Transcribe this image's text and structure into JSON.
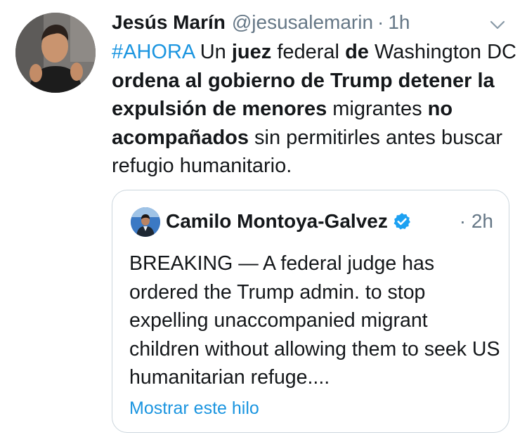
{
  "tweet": {
    "author_name": "Jesús Marín",
    "handle": "@jesusalemarin",
    "separator": "·",
    "time": "1h",
    "avatar": "avatar",
    "menu_icon": "chevron-down-icon",
    "text_segments": [
      {
        "text": "#AHORA",
        "style": "hashtag"
      },
      {
        "text": " Un ",
        "style": "normal"
      },
      {
        "text": "juez",
        "style": "bold"
      },
      {
        "text": " federal ",
        "style": "normal"
      },
      {
        "text": "de",
        "style": "bold"
      },
      {
        "text": " Washington DC ",
        "style": "normal"
      },
      {
        "text": "ordena al gobierno de Trump detener la expulsión de menores",
        "style": "bold"
      },
      {
        "text": " migrantes ",
        "style": "normal"
      },
      {
        "text": "no acompañados",
        "style": "bold"
      },
      {
        "text": " sin permitirles antes buscar refugio humanitario.",
        "style": "normal"
      }
    ]
  },
  "quoted_tweet": {
    "author_name": "Camilo Montoya-Galvez",
    "verified_icon": "verified-badge-icon",
    "separator": "·",
    "time": "2h",
    "text": "BREAKING — A federal judge has ordered the Trump admin. to stop expelling unaccompanied migrant children without allowing them to seek US humanitarian refuge....",
    "show_thread_label": "Mostrar este hilo"
  },
  "colors": {
    "text": "#14171a",
    "secondary": "#657786",
    "link": "#1b95e0",
    "border": "#ccd6dd"
  }
}
